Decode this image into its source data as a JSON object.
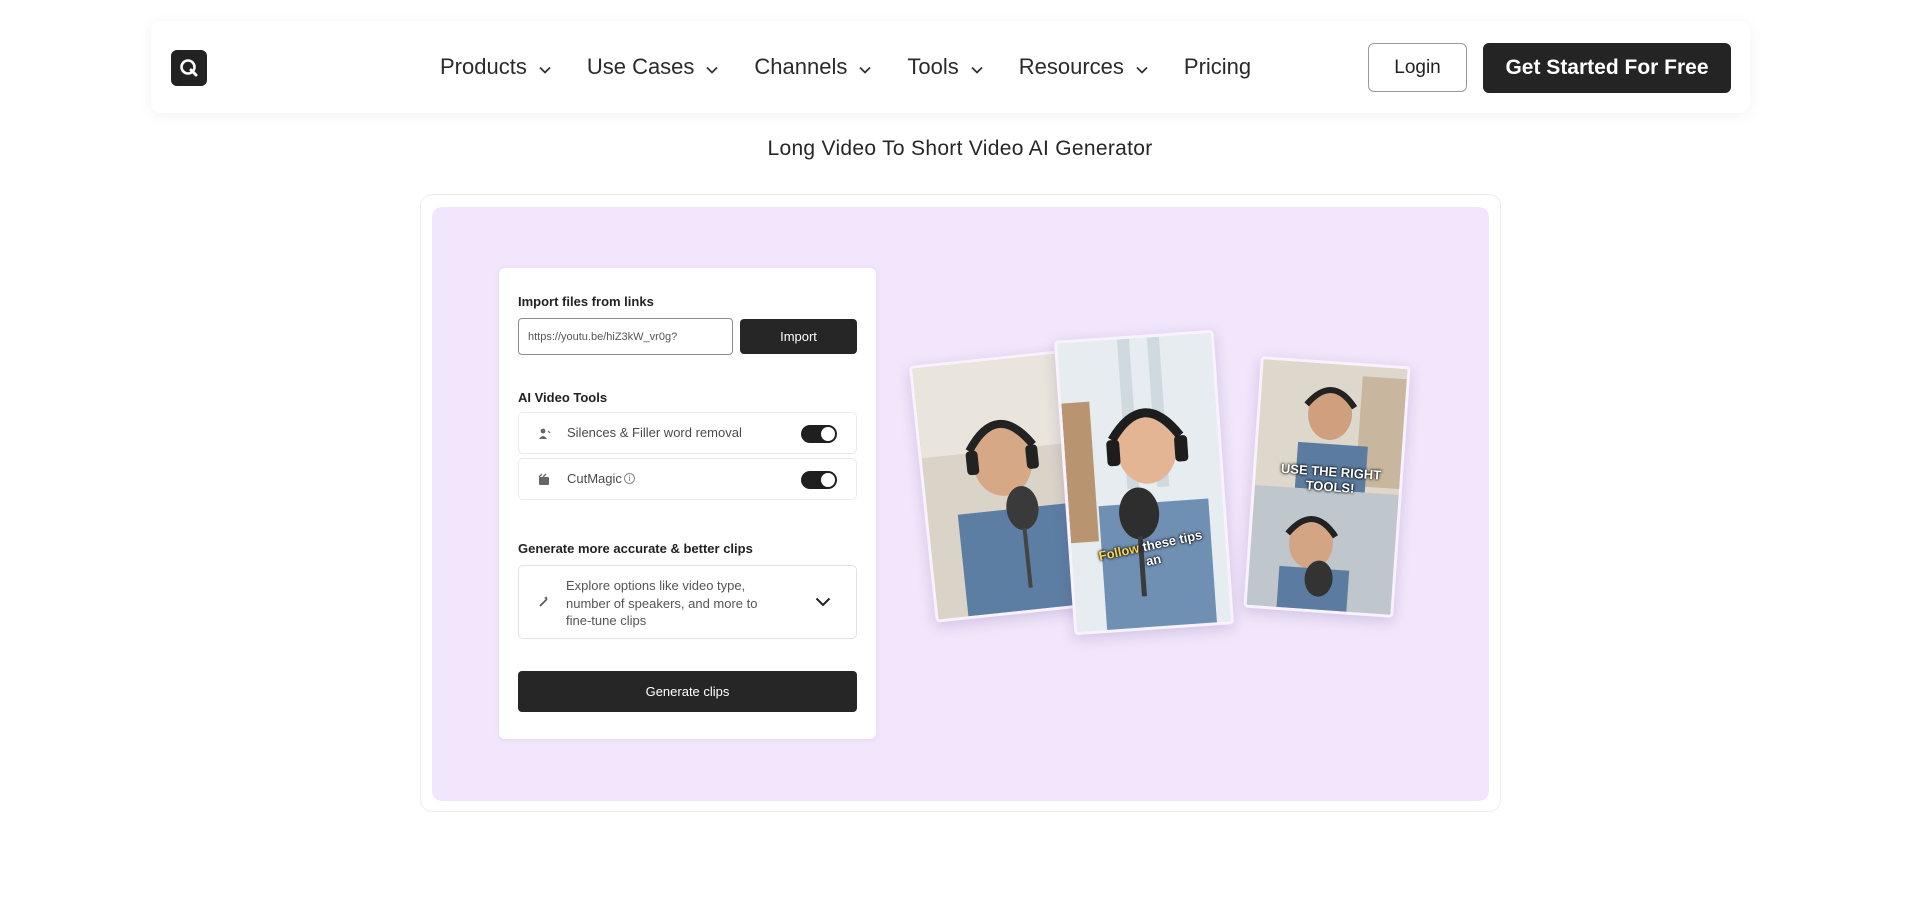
{
  "nav": {
    "items": [
      {
        "label": "Products"
      },
      {
        "label": "Use Cases"
      },
      {
        "label": "Channels"
      },
      {
        "label": "Tools"
      },
      {
        "label": "Resources"
      }
    ],
    "pricing_label": "Pricing",
    "login_label": "Login",
    "cta_label": "Get Started For Free"
  },
  "headline": "Long Video To Short Video AI Generator",
  "demo": {
    "import_heading": "Import files from links",
    "url_value": "https://youtu.be/hiZ3kW_vr0g?",
    "import_label": "Import",
    "tools_heading": "AI Video Tools",
    "tools": [
      {
        "label": "Silences & Filler word removal",
        "enabled": true,
        "icon": "silence-icon"
      },
      {
        "label": "CutMagic",
        "enabled": true,
        "icon": "cutmagic-icon"
      }
    ],
    "clips_heading": "Generate more accurate & better clips",
    "options_text": "Explore options like video type, number of speakers, and more to fine-tune clips",
    "generate_label": "Generate clips",
    "preview_captions": {
      "middle_highlight": "Follow",
      "middle_rest": "these tips an",
      "right": "USE THE RIGHT TOOLS!"
    }
  },
  "colors": {
    "accent_dark": "#242424",
    "demo_background": "#f1e6fb"
  }
}
